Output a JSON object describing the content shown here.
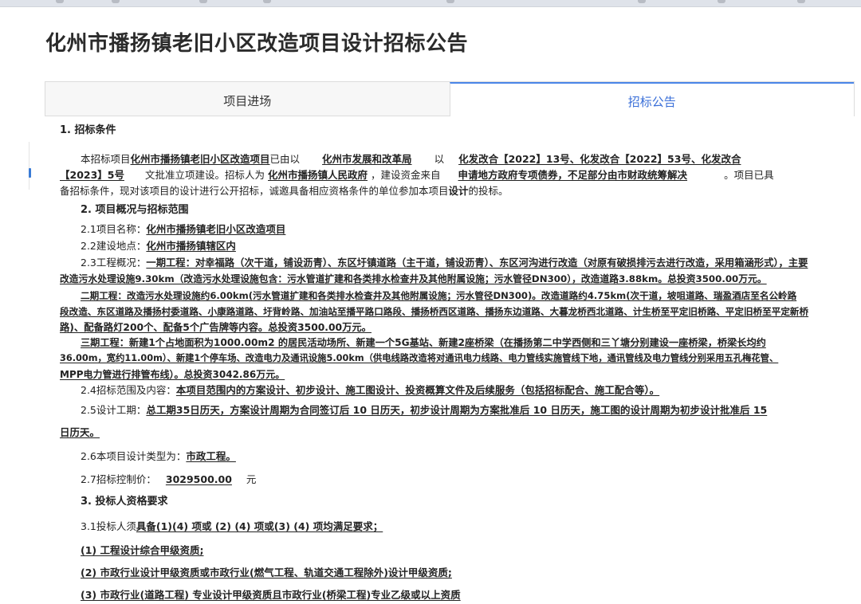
{
  "page_title": "化州市播扬镇老旧小区改造项目设计招标公告",
  "tabs": [
    {
      "label": "项目进场",
      "active": false
    },
    {
      "label": "招标公告",
      "active": true
    }
  ],
  "s1": {
    "heading": "1. 招标条件",
    "l1": {
      "a": "本招标项目",
      "project": "化州市播扬镇老旧小区改造项目",
      "b": "已由以",
      "authority": "化州市发展和改革局",
      "c": "以",
      "docs": "化发改合【2022】13号、化发改合【2022】53号、化发改合"
    },
    "l2": {
      "docs2": "【2023】5号",
      "a": "文批准立项建设。招标人为",
      "tenderer": "化州市播扬镇人民政府",
      "b": "，建设资金来自",
      "fund": "申请地方政府专项债券，不足部分由市财政统筹解决",
      "c": "。项目已具"
    },
    "l3": {
      "a": "备招标条件，现对该项目的设计进行公开招标，诚邀具备相应资格条件的单位参加本项目",
      "b": "设计",
      "c": "的投标。"
    }
  },
  "s2": {
    "heading": "2. 项目概况与招标范围",
    "name": {
      "label": "2.1项目名称：",
      "value": "化州市播扬镇老旧小区改造项目"
    },
    "site": {
      "label": "2.2建设地点：",
      "value": "化州市播扬镇辖区内"
    },
    "overview": {
      "label": "2.3工程概况：",
      "p1_1": "一期工程：对幸福路（次干道，铺设沥青）、东区圩镇道路（主干道，铺设沥青）、东区河沟进行改造（对原有破损排污去进行改造，采用箱涵形式），主要",
      "p1_2": "改造污水处理设施9.30km（改造污水处理设施包含：污水管道扩建和各类排水检查井及其他附属设施；污水管径DN300），改造道路3.88km。总投资3500.00万元。",
      "p2_1": "二期工程：改造污水处理设施约6.00km(污水管道扩建和各类排水检查井及其他附属设施；污水管径DN300)。改造道路约4.75km(次干道，坡咀道路、瑞盈酒店至名公岭路",
      "p2_2": "段改造、东区道路及播扬村委道路、小康路道路、圩背岭路、加油站至播平路口路段、播扬桥西区道路、播扬东边道路、大暮龙桥西北道路、计生桥至平定旧桥路、平定旧桥至平定新桥",
      "p2_3": "路)、配备路灯200个、配备5个广告牌等内容。总投资3500.00万元。",
      "p3_1": "三期工程：新建1个占地面积为1000.00m2 的居民活动场所、新建一个5G基站、新建2座桥梁（在播扬第二中学西侧和三丫塘分别建设一座桥梁，桥梁长均约",
      "p3_2": "36.00m，宽约11.00m）、新建1个停车场、改造电力及通讯设施5.00km（供电线路改造将对通讯电力线路、电力管线实施管线下地，通讯管线及电力管线分别采用五孔梅花管、",
      "p3_3": "MPP电力管进行排管布线）。总投资3042.86万元。"
    },
    "scope": {
      "label": "2.4招标范围及内容：",
      "value": "本项目范围内的方案设计、初步设计、施工图设计、投资概算文件及后续服务（包括招标配合、施工配合等）。"
    },
    "period": {
      "label": "2.5设计工期：",
      "value": "总工期35日历天，方案设计周期为合同签订后 10 日历天，初步设计周期为方案批准后 10 日历天，施工图的设计周期为初步设计批准后 15",
      "value2": "日历天。"
    },
    "type": {
      "label": "2.6本项目设计类型为：",
      "value": "市政工程。"
    },
    "price": {
      "label": "2.7招标控制价：",
      "value": "3029500.00",
      "unit": "元"
    }
  },
  "s3": {
    "heading": "3. 投标人资格要求",
    "req": {
      "a": "3.1投标人须",
      "b": "具备(1)(4) 项或 (2) (4) 项或(3) (4) 项均满足要求；"
    },
    "item1": "(1) 工程设计综合甲级资质;",
    "item2": "(2) 市政行业设计甲级资质或市政行业(燃气工程、轨道交通工程除外)设计甲级资质;",
    "item3": "(3) 市政行业(道路工程) 专业设计甲级资质且市政行业(桥梁工程)专业乙级或以上资质"
  }
}
